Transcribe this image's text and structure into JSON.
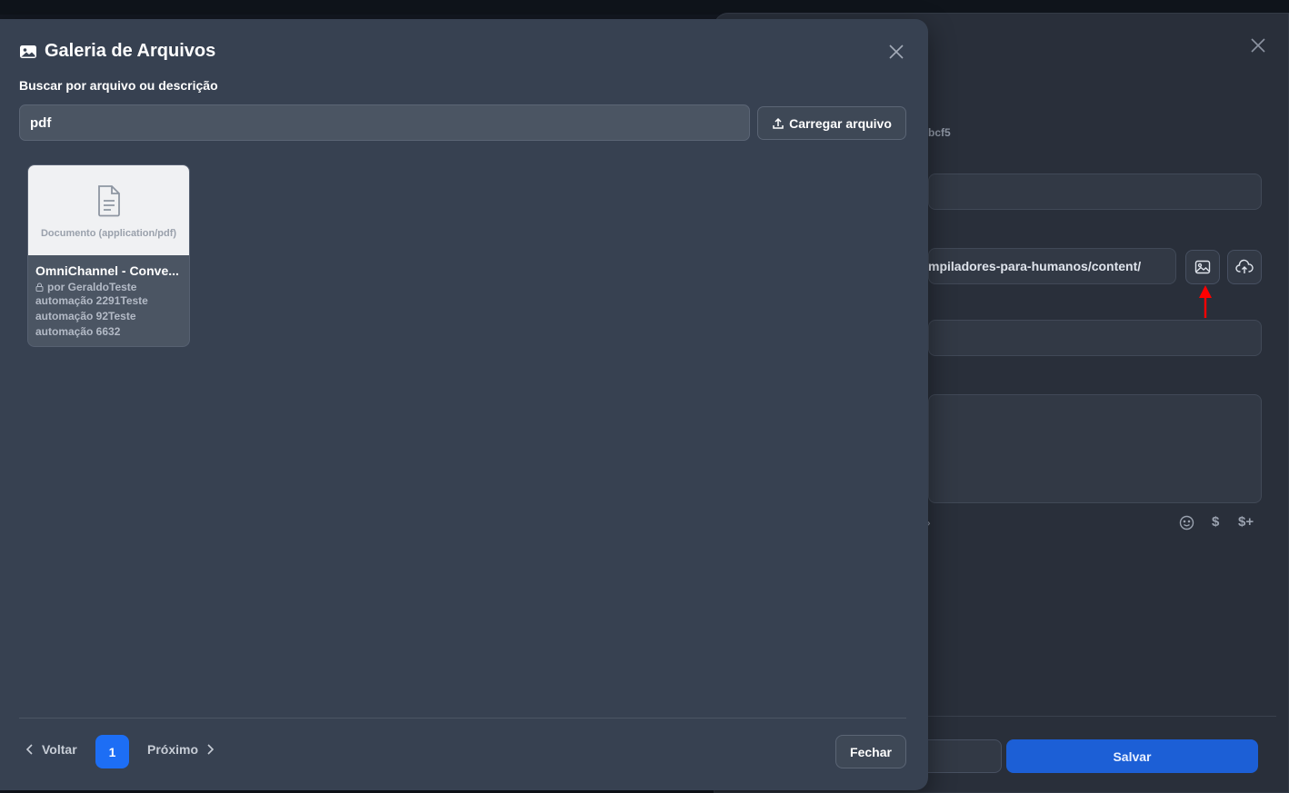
{
  "background_modal": {
    "hash_fragment": "bcf5",
    "url_value": "mpiladores-para-humanos/content/",
    "tools": [
      "emoji-icon",
      "dollar-icon",
      "dollar-plus-icon"
    ],
    "dollar_label": "$",
    "dollar_plus_label": "$+",
    "save_label": "Salvar"
  },
  "gallery": {
    "title": "Galeria de Arquivos",
    "search_label": "Buscar por arquivo ou descrição",
    "search_value": "pdf",
    "upload_label": "Carregar arquivo",
    "files": [
      {
        "type_label": "Documento (application/pdf)",
        "name": "OmniChannel - Conve...",
        "author": "por GeraldoTeste",
        "description_lines": [
          "automação 2291Teste",
          "automação 92Teste",
          "automação 6632"
        ]
      }
    ],
    "pagination": {
      "prev_label": "Voltar",
      "current_page": "1",
      "next_label": "Próximo"
    },
    "close_label": "Fechar"
  },
  "colors": {
    "modal_bg": "#374151",
    "accent": "#1d6ef5",
    "save_button": "#1c5fd6",
    "annotation_arrow": "#ff0000"
  }
}
